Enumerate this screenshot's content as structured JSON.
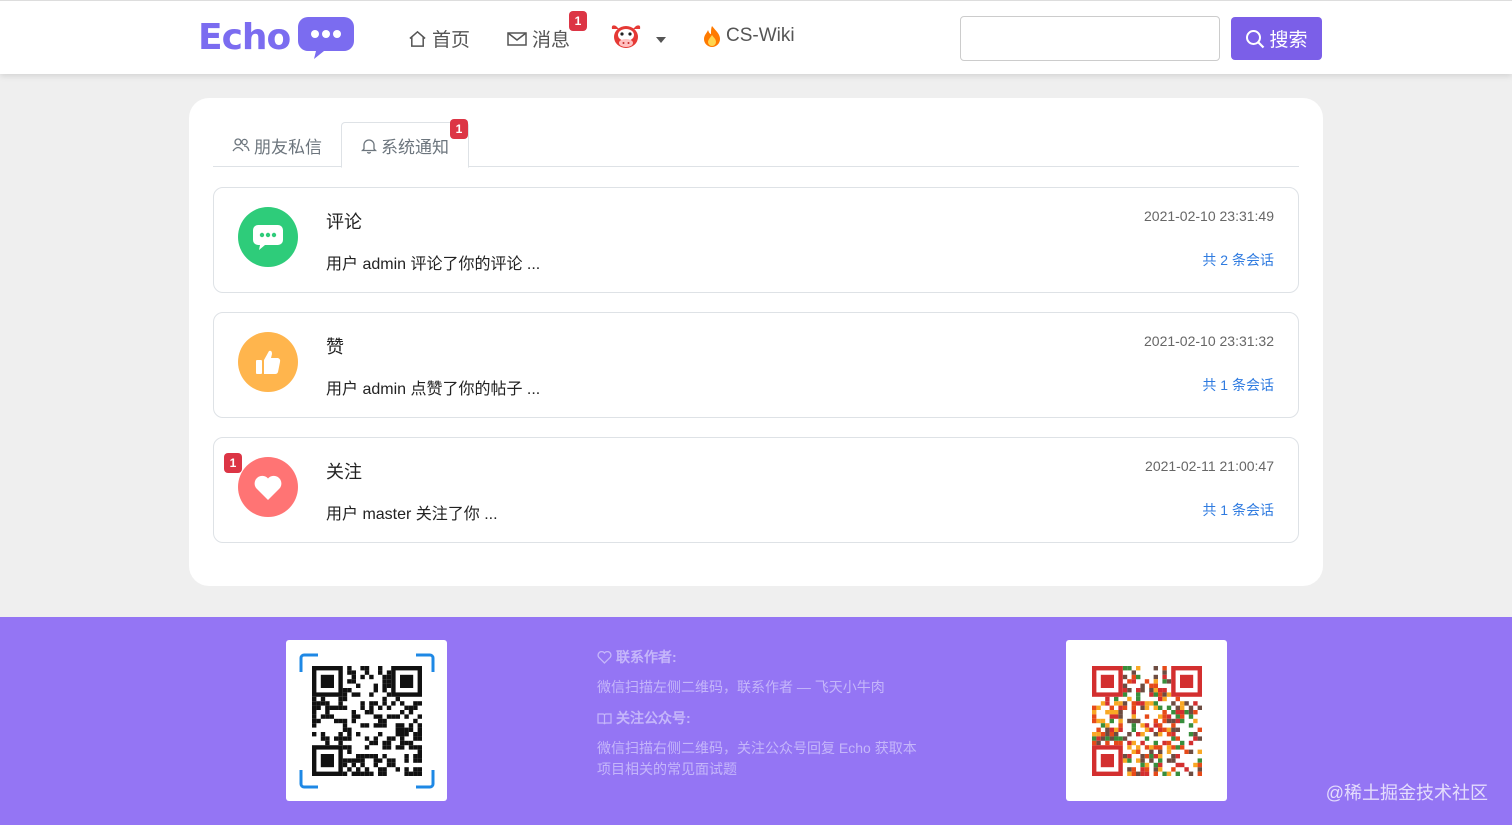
{
  "header": {
    "logo_text": "Echo",
    "nav": {
      "home_label": "首页",
      "messages_label": "消息",
      "messages_badge": "1",
      "wiki_label": "CS-Wiki"
    },
    "search": {
      "value": "",
      "placeholder": "",
      "button_label": "搜索"
    }
  },
  "tabs": [
    {
      "label": "朋友私信",
      "icon": "users-icon",
      "active": false
    },
    {
      "label": "系统通知",
      "icon": "bell-icon",
      "active": true,
      "badge": "1"
    }
  ],
  "notices": [
    {
      "title": "评论",
      "text": "用户 admin 评论了你的评论 ...",
      "time": "2021-02-10 23:31:49",
      "link": "共 2 条会话",
      "icon": "comment-icon",
      "color": "#2ecc7a"
    },
    {
      "title": "赞",
      "text": "用户 admin 点赞了你的帖子 ...",
      "time": "2021-02-10 23:31:32",
      "link": "共 1 条会话",
      "icon": "thumbs-up-icon",
      "color": "#ffb54d"
    },
    {
      "title": "关注",
      "text": "用户 master 关注了你 ...",
      "time": "2021-02-11 21:00:47",
      "link": "共 1 条会话",
      "icon": "heart-icon",
      "color": "#ff7474",
      "badge": "1"
    }
  ],
  "footer": {
    "contact_heading": "联系作者:",
    "contact_text": "微信扫描左侧二维码，联系作者 — 飞天小牛肉",
    "account_heading": "关注公众号:",
    "account_text_1": "微信扫描右侧二维码，关注公众号回复 Echo 获取本",
    "account_text_2": "项目相关的常见面试题",
    "watermark": "@稀土掘金技术社区"
  },
  "colors": {
    "accent": "#7b5fe8",
    "footer_bg": "#9475f4",
    "badge": "#dc3545",
    "link": "#2f7be0"
  }
}
